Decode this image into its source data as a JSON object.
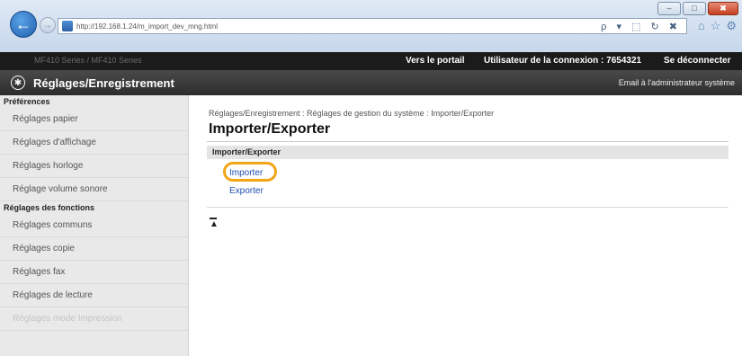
{
  "browser": {
    "url": "http://192.168.1.24/m_import_dev_mng.html",
    "url_tools": "ρ ▾ ⬚ ↻ ✖",
    "window_controls": [
      "–",
      "□",
      "✖"
    ],
    "back_icon": "←",
    "forward_icon": "→",
    "nav_icons": [
      "⌂",
      "☆",
      "⚙"
    ]
  },
  "topbar": {
    "device_name": "MF410 Series / MF410 Series",
    "portal_link": "Vers le portail",
    "user_label": "Utilisateur de la connexion :",
    "user_id": "7654321",
    "logout": "Se déconnecter"
  },
  "header": {
    "title": "Réglages/Enregistrement",
    "admin_email": "Email à l'administrateur système"
  },
  "sidebar": {
    "preferences_heading": "Préférences",
    "preferences_items": [
      "Réglages papier",
      "Réglages d'affichage",
      "Réglages horloge",
      "Réglage volume sonore"
    ],
    "functions_heading": "Réglages des fonctions",
    "functions_items": [
      "Réglages communs",
      "Réglages copie",
      "Réglages fax",
      "Réglages de lecture",
      "Réglages mode Impression"
    ]
  },
  "main": {
    "breadcrumb": "Réglages/Enregistrement : Réglages de gestion du système : Importer/Exporter",
    "page_title": "Importer/Exporter",
    "section_heading": "Importer/Exporter",
    "import_link": "Importer",
    "export_link": "Exporter"
  },
  "colors": {
    "highlight": "#f2a516",
    "link": "#1f4fb0",
    "header_bg": "#2c2c2c"
  }
}
